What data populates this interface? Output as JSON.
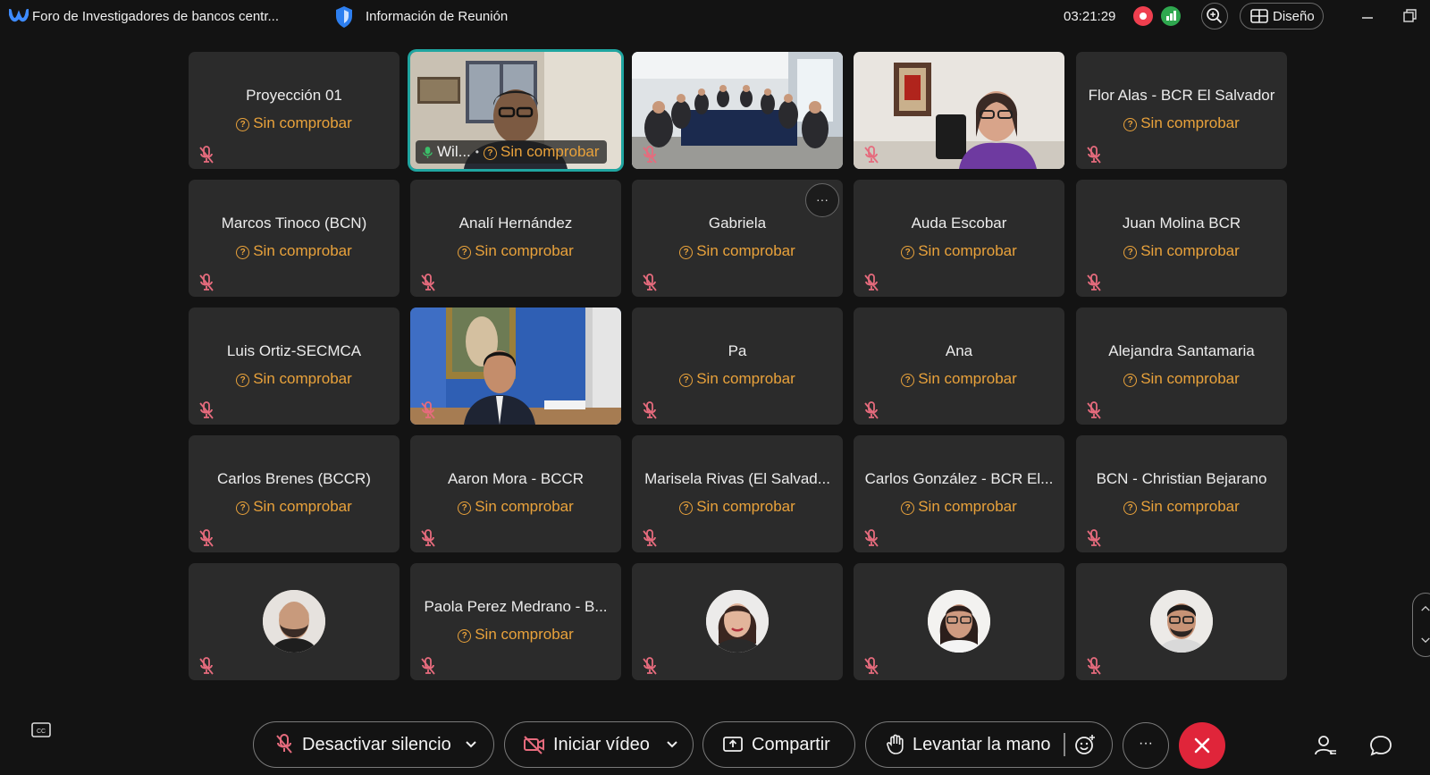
{
  "window": {
    "title": "Foro de Investigadores de bancos centr...",
    "info_label": "Información de Reunión",
    "timer": "03:21:29",
    "layout_label": "Diseño",
    "icons": [
      "webex-logo-icon",
      "shield-icon",
      "recording-icon",
      "signal-icon",
      "zoom-icon",
      "layout-icon",
      "minimize-icon",
      "restore-icon"
    ]
  },
  "status_label": "Sin comprobar",
  "tiles": [
    {
      "name": "Proyección 01",
      "status": "Sin comprobar"
    },
    {
      "name": "Wil...",
      "status": "Sin comprobar",
      "video": true,
      "active": true
    },
    {
      "name": "",
      "video": true
    },
    {
      "name": "",
      "video": true
    },
    {
      "name": "Flor Alas - BCR El Salvador",
      "status": "Sin comprobar"
    },
    {
      "name": "Marcos Tinoco (BCN)",
      "status": "Sin comprobar"
    },
    {
      "name": "Analí Hernández",
      "status": "Sin comprobar"
    },
    {
      "name": "Gabriela",
      "status": "Sin comprobar",
      "more_menu": "···"
    },
    {
      "name": "Auda Escobar",
      "status": "Sin comprobar"
    },
    {
      "name": "Juan Molina BCR",
      "status": "Sin comprobar"
    },
    {
      "name": "Luis Ortiz-SECMCA",
      "status": "Sin comprobar"
    },
    {
      "name": "",
      "video": true
    },
    {
      "name": "Pa",
      "status": "Sin comprobar"
    },
    {
      "name": "Ana",
      "status": "Sin comprobar"
    },
    {
      "name": "Alejandra Santamaria",
      "status": "Sin comprobar"
    },
    {
      "name": "Carlos Brenes (BCCR)",
      "status": "Sin comprobar"
    },
    {
      "name": "Aaron Mora - BCCR",
      "status": "Sin comprobar"
    },
    {
      "name": "Marisela Rivas (El Salvad...",
      "status": "Sin comprobar"
    },
    {
      "name": "Carlos González - BCR El...",
      "status": "Sin comprobar"
    },
    {
      "name": "BCN - Christian Bejarano",
      "status": "Sin comprobar"
    },
    {
      "name": "",
      "avatar": "man-avatar"
    },
    {
      "name": "Paola Perez Medrano - B...",
      "status": "Sin comprobar"
    },
    {
      "name": "",
      "avatar": "woman-avatar"
    },
    {
      "name": "",
      "avatar": "woman-glasses-avatar"
    },
    {
      "name": "",
      "avatar": "man-glasses-avatar"
    }
  ],
  "controls": {
    "unmute": "Desactivar silencio",
    "start_video": "Iniciar vídeo",
    "share": "Compartir",
    "raise_hand": "Levantar la mano",
    "more": "···"
  },
  "colors": {
    "background": "#131313",
    "tile": "#2b2b2b",
    "status": "#e9a23b",
    "active_border": "#1fa5a0",
    "end_call": "#e0253a",
    "muted_icon": "#e66b7d"
  }
}
